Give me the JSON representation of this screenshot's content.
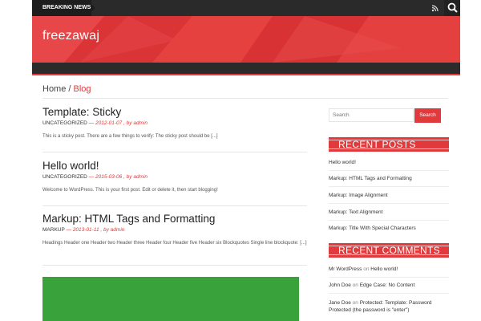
{
  "topbar": {
    "breaking_label": "BREAKING NEWS",
    "rss_icon": "rss-icon",
    "search_icon": "search-icon"
  },
  "header": {
    "site_title": "freezawaj"
  },
  "breadcrumb": {
    "home": "Home",
    "separator": "/",
    "current": "Blog"
  },
  "posts": [
    {
      "title": "Template: Sticky",
      "category": "UNCATEGORIZED",
      "date": "— 2012-01-07 ,",
      "author": "by admin",
      "excerpt": "This is a sticky post. There are a few things to verify: The sticky post should be [...]"
    },
    {
      "title": "Hello world!",
      "category": "UNCATEGORIZED",
      "date": "— 2015-03-06 ,",
      "author": "by admin",
      "excerpt": "Welcome to WordPress. This is your first post. Edit or delete it, then start blogging!"
    },
    {
      "title": "Markup: HTML Tags and Formatting",
      "category": "MARKUP",
      "date": "— 2013-01-11 ,",
      "author": "by admin",
      "excerpt": "Headings Header one Header two Header three Header four Header five Header six Blockquotes Single line blockquote: [...]"
    }
  ],
  "sidebar": {
    "search_placeholder": "Search",
    "search_button": "Search",
    "recent_posts_title": "RECENT POSTS",
    "recent_posts": [
      "Hello world!",
      "Markup: HTML Tags and Formatting",
      "Markup: Image Alignment",
      "Markup: Text Alignment",
      "Markup: Title With Special Characters"
    ],
    "recent_comments_title": "RECENT COMMENTS",
    "recent_comments": [
      {
        "author": "Mr WordPress",
        "on": "on",
        "post": "Hello world!"
      },
      {
        "author": "John Doe",
        "on": "on",
        "post": "Edge Case: No Content"
      },
      {
        "author": "Jane Doe",
        "on": "on",
        "post": "Protected: Template: Password Protected (the password is \"enter\")"
      }
    ]
  },
  "colors": {
    "accent": "#e03a3c",
    "dark": "#2a2a2a",
    "featured_image": "#3aa23a"
  }
}
